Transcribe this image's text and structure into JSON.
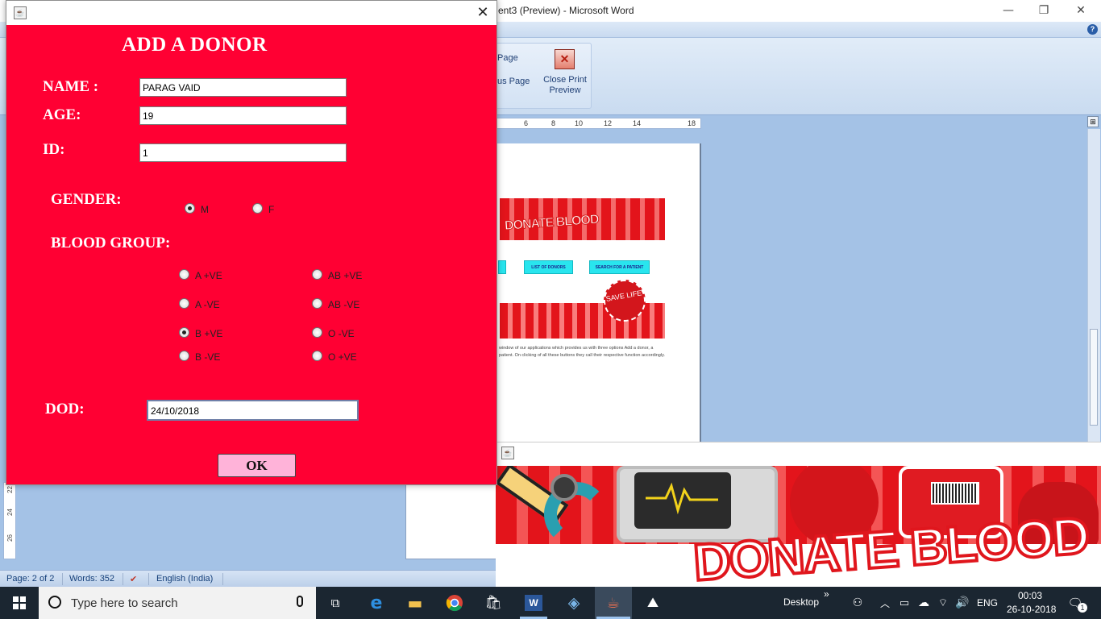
{
  "word": {
    "title": "ent3 (Preview) - Microsoft Word",
    "window_controls": {
      "minimize": "—",
      "restore": "❐",
      "close": "✕"
    },
    "help": "?",
    "ribbon": {
      "next_page": "Page",
      "previous_page": "us Page",
      "close_icon": "✕",
      "close_print_preview": "Close Print Preview"
    },
    "ruler_numbers": [
      "6",
      "8",
      "10",
      "12",
      "14",
      "18"
    ],
    "left_ruler_numbers": [
      "22",
      "24",
      "26"
    ],
    "preview": {
      "banner_text": "DONATE BLOOD",
      "buttons": [
        "LIST OF DONORS",
        "SEARCH FOR A PATIENT"
      ],
      "save_life": "SAVE LIFE",
      "paragraph": "window of our applications which provides us with three options Add a donor, a patient. On clicking of all these buttons they call their respective function accordingly."
    },
    "status": {
      "page": "Page: 2 of 2",
      "words": "Words: 352",
      "language": "English (India)"
    }
  },
  "banner_window": {
    "banner_text": "DONATE BLOOD",
    "java_icon": "☕"
  },
  "donor_form": {
    "java_icon": "☕",
    "close": "✕",
    "title": "ADD A DONOR",
    "labels": {
      "name": "NAME :",
      "age": "AGE:",
      "id": "ID:",
      "gender": "GENDER:",
      "blood_group": "BLOOD GROUP:",
      "dod": "DOD:"
    },
    "fields": {
      "name": "PARAG VAID",
      "age": "19",
      "id": "1",
      "dod": "24/10/2018"
    },
    "gender": {
      "options": [
        "M",
        "F"
      ],
      "selected": "M"
    },
    "blood_groups": {
      "left": [
        "A +VE",
        "A -VE",
        "B +VE",
        "B -VE"
      ],
      "right": [
        "AB +VE",
        "AB -VE",
        "O -VE",
        "O +VE"
      ],
      "selected": "B +VE"
    },
    "ok_label": "OK"
  },
  "taskbar": {
    "search_placeholder": "Type here to search",
    "desktop_label": "Desktop",
    "desktop_chevron": "»",
    "language": "ENG",
    "time": "00:03",
    "date": "26-10-2018",
    "notification_count": "1",
    "word_icon_text": "W"
  }
}
